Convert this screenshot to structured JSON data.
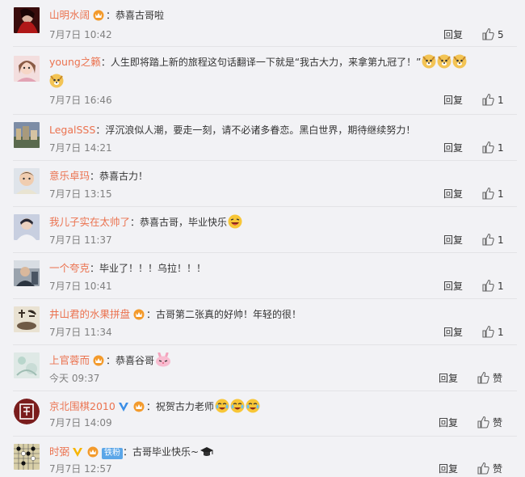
{
  "comments": [
    {
      "user": "山明水阔",
      "sep": "：",
      "text": "恭喜古哥啦",
      "time": "7月7日 10:42",
      "reply": "回复",
      "likes": "5"
    },
    {
      "user": "young之籁",
      "sep": "：",
      "text": "人生即将踏上新的旅程这句话翻译一下就是“我古大力，来拿第九冠了！”",
      "time": "7月7日 16:46",
      "reply": "回复",
      "likes": "1"
    },
    {
      "user": "LegalSSS",
      "sep": "：",
      "text": "浮沉浪似人潮，要走一刻，请不必诸多眷恋。黑白世界，期待继续努力！",
      "time": "7月7日 14:21",
      "reply": "回复",
      "likes": "1"
    },
    {
      "user": "意乐卓玛",
      "sep": "：",
      "text": "恭喜古力！",
      "time": "7月7日 13:15",
      "reply": "回复",
      "likes": "1"
    },
    {
      "user": "我儿子实在太帅了",
      "sep": "：",
      "text": "恭喜古哥，毕业快乐",
      "time": "7月7日 11:37",
      "reply": "回复",
      "likes": "1"
    },
    {
      "user": "一个夸克",
      "sep": "：",
      "text": "毕业了！！！乌拉！！！",
      "time": "7月7日 10:41",
      "reply": "回复",
      "likes": "1"
    },
    {
      "user": "井山君的水果拼盘",
      "sep": "：",
      "text": "古哥第二张真的好帅！年轻的很！",
      "time": "7月7日 11:34",
      "reply": "回复",
      "likes": "1"
    },
    {
      "user": "上官蓉而",
      "sep": "：",
      "text": "恭喜谷哥",
      "time": "今天 09:37",
      "reply": "回复",
      "likes": "赞"
    },
    {
      "user": "京北围棋2010",
      "sep": "：",
      "text": "祝贺古力老师",
      "time": "7月7日 14:09",
      "reply": "回复",
      "likes": "赞"
    },
    {
      "user": "时弼",
      "sep": "：",
      "text": "古哥毕业快乐~",
      "time": "7月7日 12:57",
      "reply": "回复",
      "likes": "赞",
      "badge": "铁粉"
    }
  ],
  "colors": {
    "username": "#eb7350",
    "background": "#f2f2f5",
    "time": "#808080",
    "vip": "#f7b500"
  }
}
